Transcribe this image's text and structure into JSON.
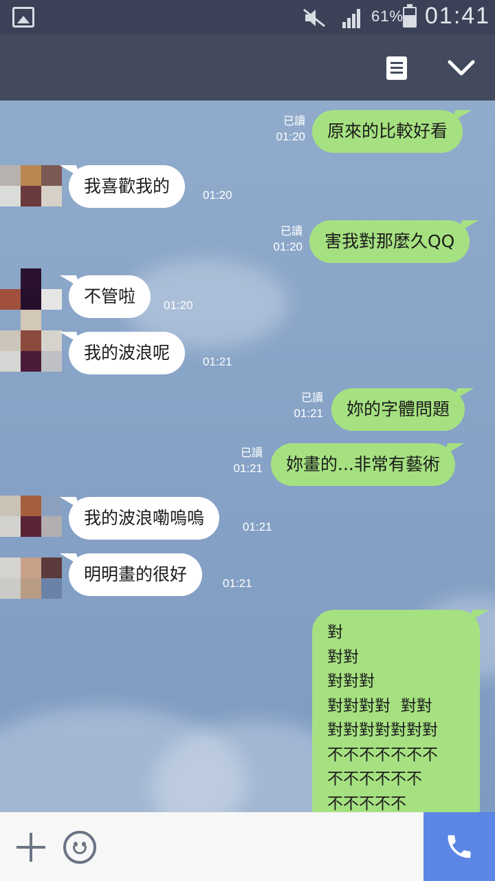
{
  "status_bar": {
    "battery_percent": "61%",
    "battery_level": 0.61,
    "time": "01:41",
    "icons": [
      "gallery-icon",
      "mute-icon",
      "signal-icon",
      "battery-icon"
    ]
  },
  "header": {
    "icons": [
      "note-icon",
      "chevron-down-icon"
    ]
  },
  "messages": [
    {
      "side": "out",
      "text": "原來的比較好看",
      "read": "已讀",
      "time": "01:20"
    },
    {
      "side": "in",
      "text": "我喜歡我的",
      "time": "01:20"
    },
    {
      "side": "out",
      "text": "害我對那麼久QQ",
      "read": "已讀",
      "time": "01:20"
    },
    {
      "side": "in",
      "text": "不管啦",
      "time": "01:20"
    },
    {
      "side": "in",
      "text": "我的波浪呢",
      "time": "01:21"
    },
    {
      "side": "out",
      "text": "妳的字體問題",
      "read": "已讀",
      "time": "01:21"
    },
    {
      "side": "out",
      "text": "妳畫的...非常有藝術",
      "read": "已讀",
      "time": "01:21"
    },
    {
      "side": "in",
      "text": "我的波浪嘞嗚嗚",
      "time": "01:21"
    },
    {
      "side": "in",
      "text": "明明畫的很好",
      "time": "01:21"
    }
  ],
  "last_message_lines": [
    "對",
    "對對",
    "對對對",
    "對對對對  對對",
    "對對對對對對對",
    "不不不不不不不",
    "不不不不不不",
    "不不不不不"
  ],
  "input_bar": {
    "icons": [
      "plus-icon",
      "emoji-icon",
      "phone-icon"
    ],
    "call_color": "#5b86e5"
  },
  "colors": {
    "outgoing_bubble": "#a6e181",
    "incoming_bubble": "#ffffff",
    "header": "#434a5e",
    "status_bar": "#3b4257"
  }
}
